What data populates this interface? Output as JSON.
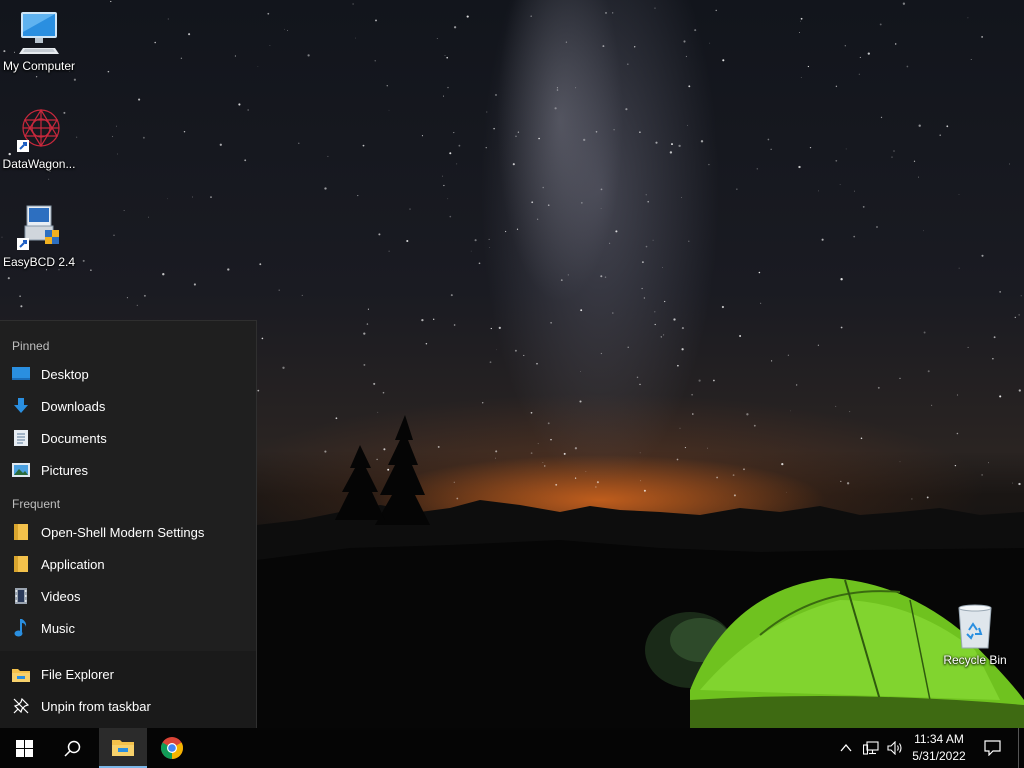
{
  "desktop": {
    "icons": [
      {
        "label": "My Computer",
        "icon": "computer-icon"
      },
      {
        "label": "DataWagon...",
        "icon": "datawagon-icon"
      },
      {
        "label": "EasyBCD 2.4",
        "icon": "easybcd-icon"
      },
      {
        "label": "Recycle Bin",
        "icon": "recycle-bin-icon"
      }
    ]
  },
  "jumplist": {
    "pinned_header": "Pinned",
    "pinned": [
      {
        "label": "Desktop",
        "icon": "desktop-folder-icon"
      },
      {
        "label": "Downloads",
        "icon": "download-arrow-icon"
      },
      {
        "label": "Documents",
        "icon": "document-icon"
      },
      {
        "label": "Pictures",
        "icon": "pictures-icon"
      }
    ],
    "frequent_header": "Frequent",
    "frequent": [
      {
        "label": "Open-Shell Modern Settings",
        "icon": "folder-icon"
      },
      {
        "label": "Application",
        "icon": "folder-icon"
      },
      {
        "label": "Videos",
        "icon": "videos-icon"
      },
      {
        "label": "Music",
        "icon": "music-note-icon"
      }
    ],
    "actions": [
      {
        "label": "File Explorer",
        "icon": "file-explorer-icon"
      },
      {
        "label": "Unpin from taskbar",
        "icon": "unpin-icon"
      }
    ]
  },
  "taskbar": {
    "buttons": [
      "start-icon",
      "search-icon",
      "file-explorer-icon",
      "chrome-icon"
    ],
    "active_button": "file-explorer-icon",
    "tray": [
      "chevron-up-icon",
      "network-icon",
      "volume-icon",
      "notification-icon"
    ],
    "time": "11:34 AM",
    "date": "5/31/2022"
  },
  "colors": {
    "taskbar_bg": "#050505",
    "jumplist_bg": "#1f1f1f",
    "accent": "#7cb7e8"
  }
}
